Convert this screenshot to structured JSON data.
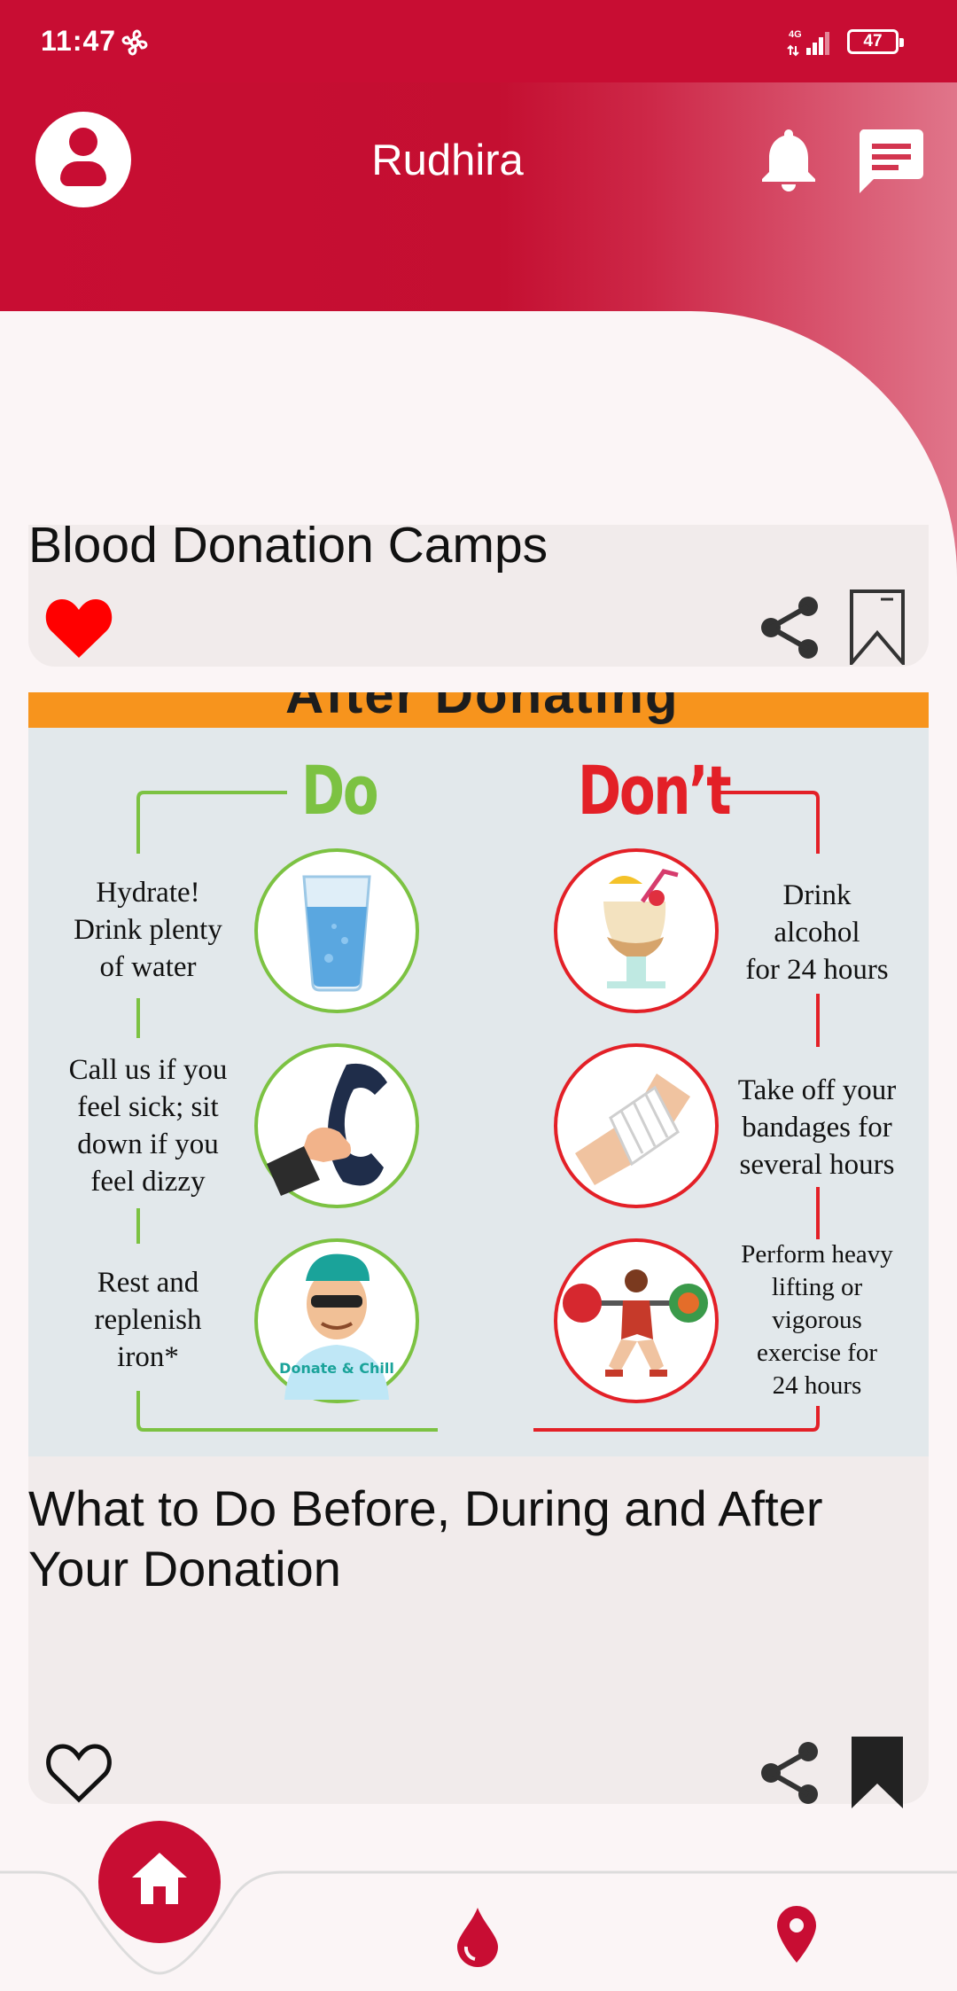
{
  "status_bar": {
    "time": "11:47",
    "network": "4G",
    "battery": "47"
  },
  "header": {
    "title": "Rudhira",
    "icons": [
      "account-icon",
      "bell-icon",
      "chat-icon"
    ]
  },
  "posts": [
    {
      "title": "Blood Donation Camps",
      "liked": true,
      "bookmarked": false
    },
    {
      "title": "What to Do Before, During and After Your Donation",
      "liked": false,
      "bookmarked": true,
      "image": {
        "banner_text": "After Donating",
        "do_heading": "Do",
        "dont_heading": "Don’t",
        "do_items": [
          [
            "Hydrate!",
            "Drink plenty",
            "of water"
          ],
          [
            "Call us if you",
            "feel sick; sit",
            "down if you",
            "feel dizzy"
          ],
          [
            "Rest and",
            "replenish",
            "iron*"
          ]
        ],
        "dont_items": [
          [
            "Drink",
            "alcohol",
            "for 24 hours"
          ],
          [
            "Take off your",
            "bandages for",
            "several hours"
          ],
          [
            "Perform heavy",
            "lifting or",
            "vigorous",
            "exercise for",
            "24 hours"
          ]
        ],
        "shirt_text": "Donate & Chill"
      }
    }
  ],
  "bottom_nav": {
    "items": [
      "home-icon",
      "blood-drop-icon",
      "location-pin-icon"
    ],
    "active": "home-icon"
  },
  "colors": {
    "primary": "#c80d33",
    "like_red": "#ff0000",
    "do_green": "#7cc242",
    "dont_red": "#e32027",
    "banner_orange": "#f7941d"
  }
}
